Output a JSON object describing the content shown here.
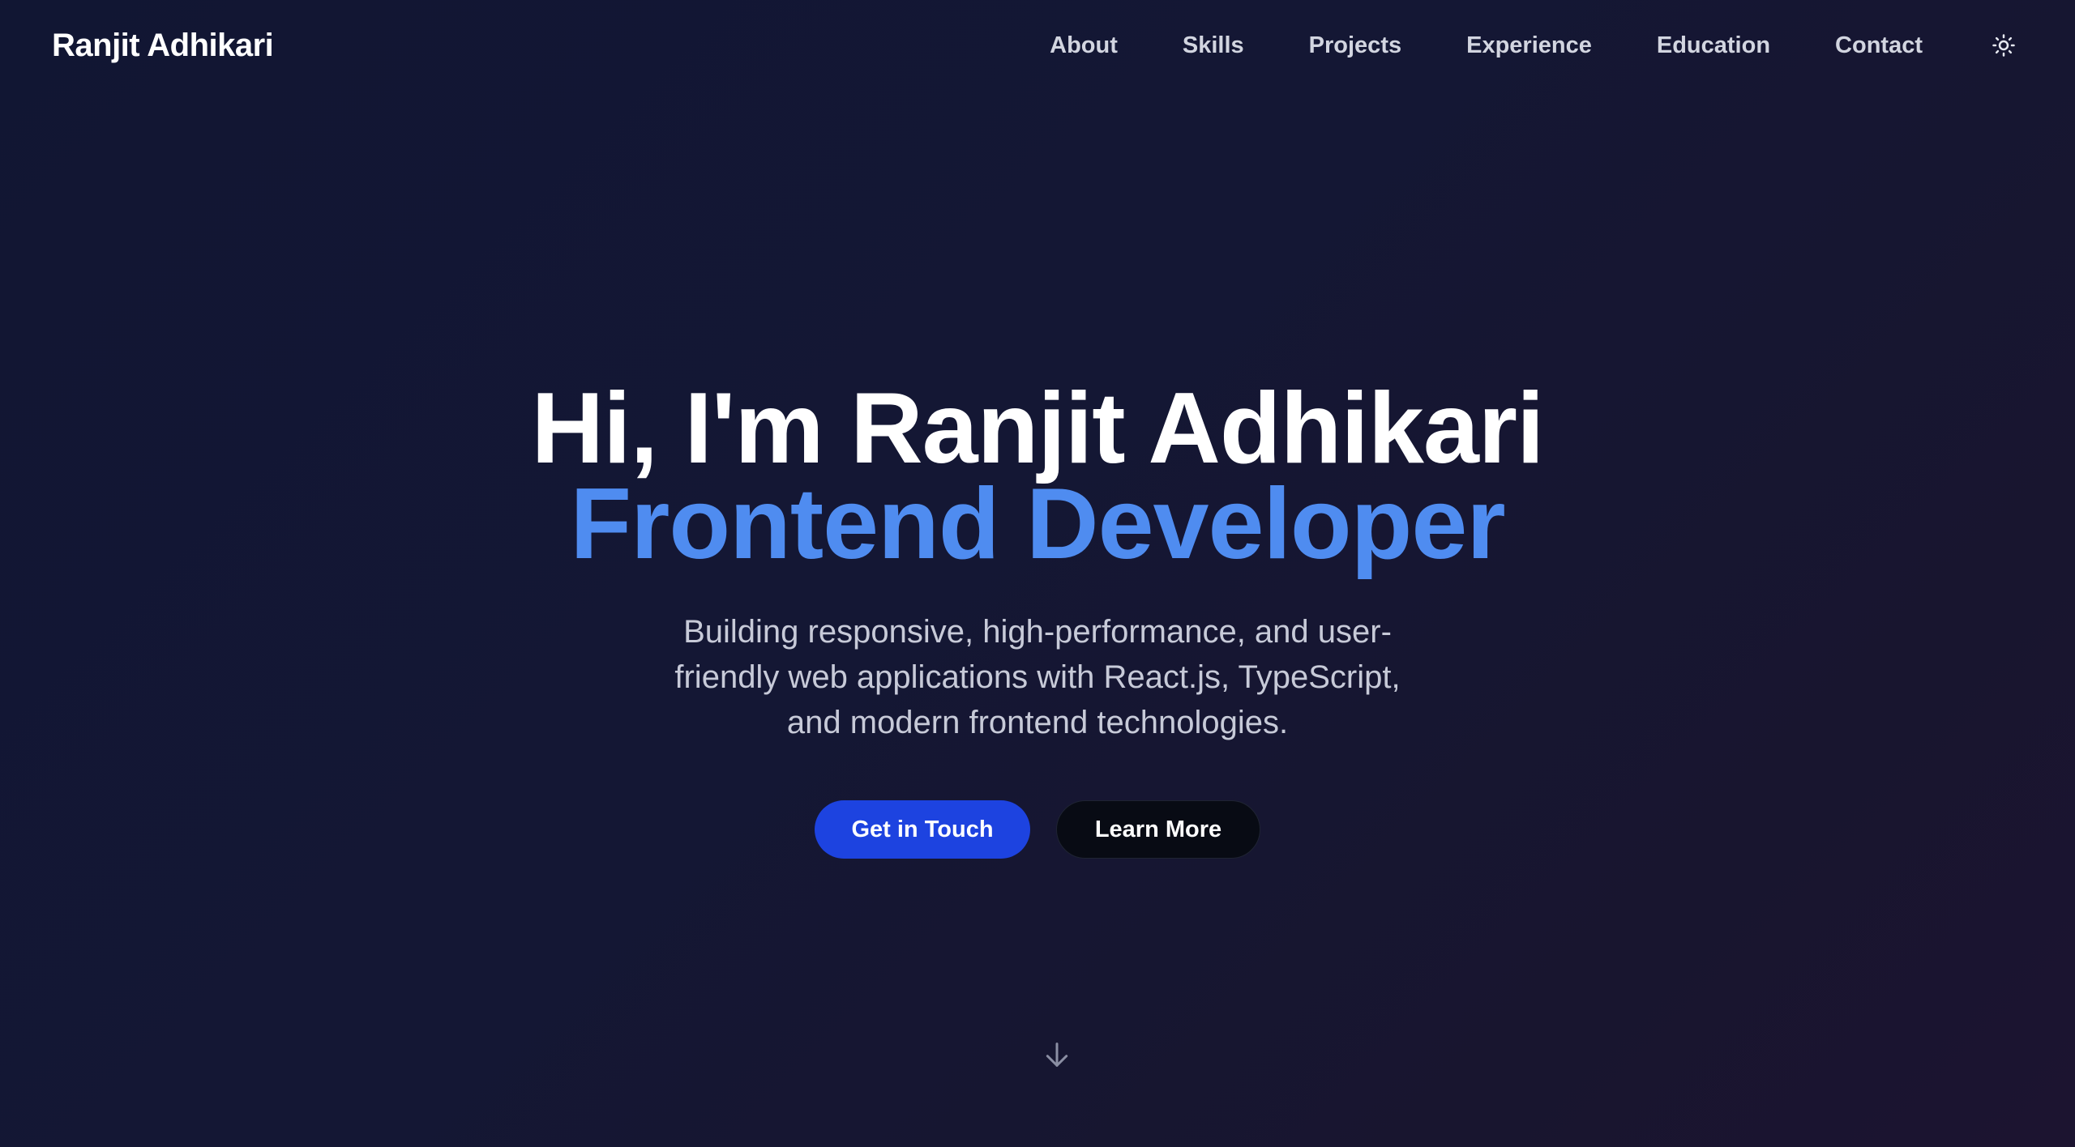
{
  "nav": {
    "brand": "Ranjit Adhikari",
    "links": [
      {
        "label": "About"
      },
      {
        "label": "Skills"
      },
      {
        "label": "Projects"
      },
      {
        "label": "Experience"
      },
      {
        "label": "Education"
      },
      {
        "label": "Contact"
      }
    ],
    "theme_toggle_icon": "sun-icon"
  },
  "hero": {
    "title_line1": "Hi, I'm Ranjit Adhikari",
    "title_line2": "Frontend Developer",
    "subtitle": "Building responsive, high-performance, and user-friendly web applications with React.js, TypeScript, and modern frontend technologies.",
    "primary_button": "Get in Touch",
    "secondary_button": "Learn More",
    "scroll_icon": "arrow-down-icon"
  },
  "colors": {
    "background": "#131632",
    "accent": "#4f8cf0",
    "primary_button": "#1d43e0",
    "secondary_button": "#080b14",
    "nav_text": "#d2d5e0",
    "body_text": "#c7cad8"
  }
}
